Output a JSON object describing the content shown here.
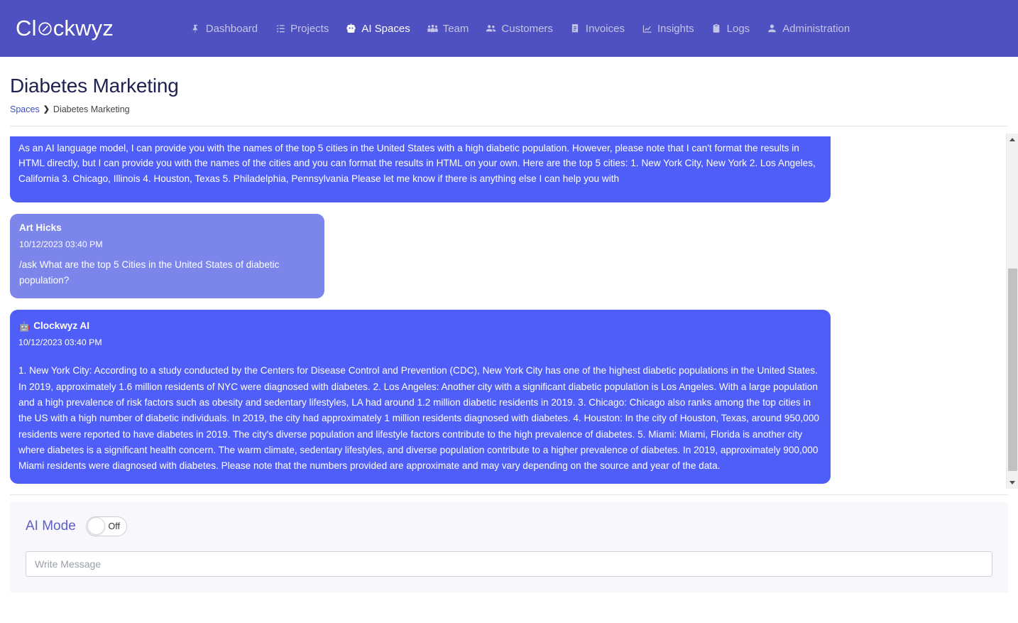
{
  "brand": {
    "name_before": "Cl",
    "name_after": "ckwyz",
    "logo_icon": "clock-icon"
  },
  "colors": {
    "header_bg": "#4e51bf",
    "ai_bubble": "#4f5ef7",
    "user_bubble": "#7b85ea",
    "accent": "#5b5fc7",
    "title": "#1f2151",
    "composer_bg": "#f8f8fc"
  },
  "nav": {
    "items": [
      {
        "label": "Dashboard",
        "icon": "pin-icon",
        "active": false
      },
      {
        "label": "Projects",
        "icon": "list-check-icon",
        "active": false
      },
      {
        "label": "AI Spaces",
        "icon": "robot-icon",
        "active": true
      },
      {
        "label": "Team",
        "icon": "people-group-icon",
        "active": false
      },
      {
        "label": "Customers",
        "icon": "users-icon",
        "active": false
      },
      {
        "label": "Invoices",
        "icon": "receipt-icon",
        "active": false
      },
      {
        "label": "Insights",
        "icon": "chart-line-icon",
        "active": false
      },
      {
        "label": "Logs",
        "icon": "clipboard-icon",
        "active": false
      },
      {
        "label": "Administration",
        "icon": "user-icon",
        "active": false
      }
    ]
  },
  "page": {
    "title": "Diabetes Marketing",
    "breadcrumb": {
      "root": "Spaces",
      "separator": "❯",
      "current": "Diabetes Marketing"
    }
  },
  "chat": {
    "messages": [
      {
        "id": "msg-0",
        "kind": "ai",
        "clipped": true,
        "body": "As an AI language model, I can provide you with the names of the top 5 cities in the United States with a high diabetic population. However, please note that I can't format the results in HTML directly, but I can provide you with the names of the cities and you can format the results in HTML on your own. Here are the top 5 cities: 1. New York City, New York 2. Los Angeles, California 3. Chicago, Illinois 4. Houston, Texas 5. Philadelphia, Pennsylvania Please let me know if there is anything else I can help you with"
      },
      {
        "id": "msg-1",
        "kind": "user",
        "author": "Art Hicks",
        "timestamp": "10/12/2023 03:40 PM",
        "body": "/ask What are the top 5 Cities in the United States of diabetic population?"
      },
      {
        "id": "msg-2",
        "kind": "ai",
        "author": "Clockwyz AI",
        "author_icon": "🤖",
        "timestamp": "10/12/2023 03:40 PM",
        "body": "1. New York City: According to a study conducted by the Centers for Disease Control and Prevention (CDC), New York City has one of the highest diabetic populations in the United States. In 2019, approximately 1.6 million residents of NYC were diagnosed with diabetes. 2. Los Angeles: Another city with a significant diabetic population is Los Angeles. With a large population and a high prevalence of risk factors such as obesity and sedentary lifestyles, LA had around 1.2 million diabetic residents in 2019. 3. Chicago: Chicago also ranks among the top cities in the US with a high number of diabetic individuals. In 2019, the city had approximately 1 million residents diagnosed with diabetes. 4. Houston: In the city of Houston, Texas, around 950,000 residents were reported to have diabetes in 2019. The city's diverse population and lifestyle factors contribute to the high prevalence of diabetes. 5. Miami: Miami, Florida is another city where diabetes is a significant health concern. The warm climate, sedentary lifestyles, and diverse population contribute to a higher prevalence of diabetes. In 2019, approximately 900,000 Miami residents were diagnosed with diabetes. Please note that the numbers provided are approximate and may vary depending on the source and year of the data."
      }
    ]
  },
  "composer": {
    "ai_mode_label": "AI Mode",
    "toggle_state": "Off",
    "message_placeholder": "Write Message",
    "message_value": ""
  },
  "scrollbar": {
    "up_icon": "caret-up-icon",
    "down_icon": "caret-down-icon"
  }
}
